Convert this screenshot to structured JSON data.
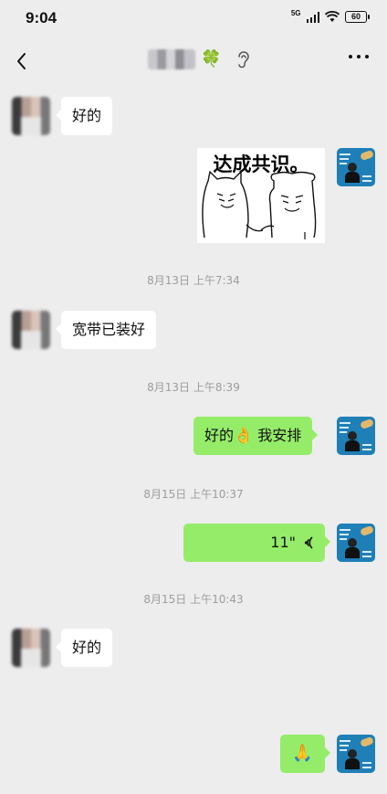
{
  "status_bar": {
    "time": "9:04",
    "network": "5G",
    "battery": "60"
  },
  "nav": {
    "title_blurred": true,
    "title_emoji": "🍀"
  },
  "messages": [
    {
      "side": "left",
      "type": "text",
      "text": "好的"
    },
    {
      "side": "right",
      "type": "sticker",
      "caption": "达成共识。"
    },
    {
      "type": "time",
      "text": "8月13日 上午7:34"
    },
    {
      "side": "left",
      "type": "text",
      "text": "宽带已装好"
    },
    {
      "type": "time",
      "text": "8月13日 上午8:39"
    },
    {
      "side": "right",
      "type": "text",
      "text_before": "好的",
      "emoji": "👌",
      "text_after": " 我安排"
    },
    {
      "type": "time",
      "text": "8月15日 上午10:37"
    },
    {
      "side": "right",
      "type": "voice",
      "duration": "11\""
    },
    {
      "type": "time",
      "text": "8月15日 上午10:43"
    },
    {
      "side": "left",
      "type": "text",
      "text": "好的"
    },
    {
      "side": "right",
      "type": "emoji",
      "emoji": "🙏"
    }
  ],
  "colors": {
    "background": "#ededed",
    "bubble_self": "#95ec69",
    "bubble_other": "#ffffff",
    "timestamp": "#9d9d9d"
  }
}
